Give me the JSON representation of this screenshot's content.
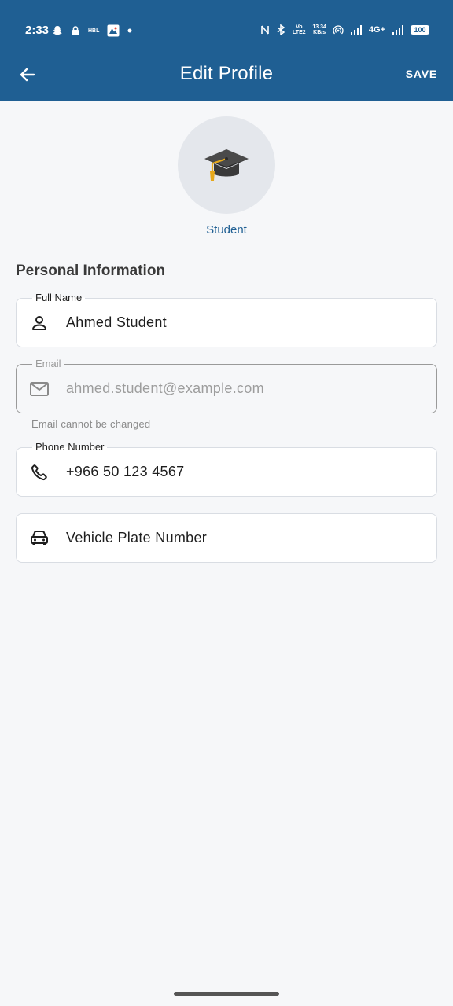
{
  "status_bar": {
    "time": "2:33",
    "network_speed_value": "13.34",
    "network_speed_unit": "KB/s",
    "volte_label": "Vo LTE2",
    "network_type": "4G+",
    "battery": "100",
    "hbl_label": "HBL"
  },
  "app_bar": {
    "title": "Edit Profile",
    "save_label": "SAVE"
  },
  "profile": {
    "role": "Student",
    "avatar_icon": "graduation-cap-icon"
  },
  "section": {
    "title": "Personal Information"
  },
  "fields": {
    "full_name": {
      "label": "Full Name",
      "value": "Ahmed Student",
      "icon": "person-icon"
    },
    "email": {
      "label": "Email",
      "value": "ahmed.student@example.com",
      "icon": "mail-icon",
      "helper": "Email cannot be changed"
    },
    "phone": {
      "label": "Phone Number",
      "value": "+966 50 123 4567",
      "icon": "phone-icon"
    },
    "vehicle": {
      "placeholder": "Vehicle Plate Number",
      "icon": "car-icon"
    }
  },
  "colors": {
    "primary": "#1f5f93",
    "background": "#f6f7f9",
    "field_border": "#d9dde3",
    "disabled_border": "#9a9a9a",
    "disabled_text": "#9d9d9d",
    "graduation_tassel": "#e6a81a"
  }
}
